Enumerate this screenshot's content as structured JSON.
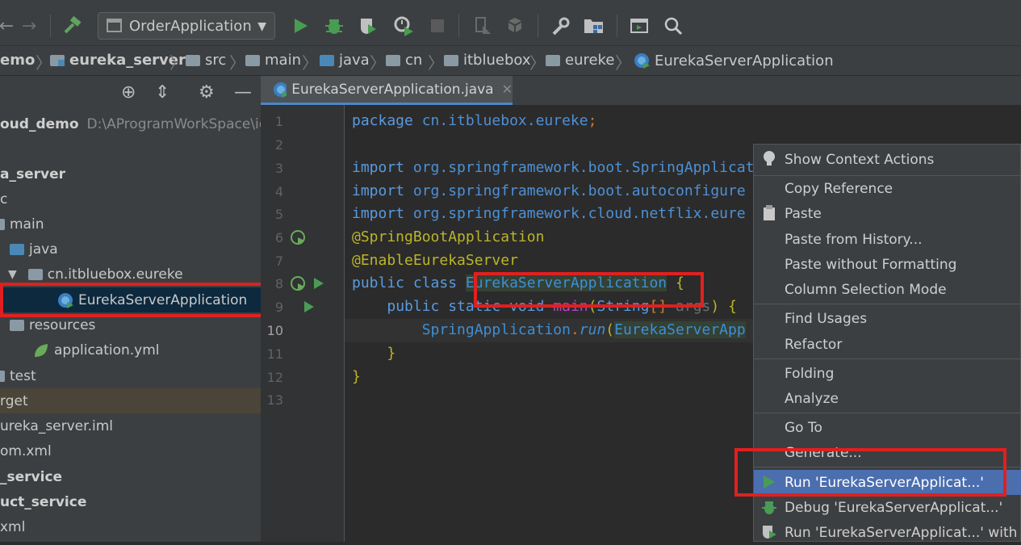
{
  "toolbar": {
    "run_config": "OrderApplication"
  },
  "breadcrumb": [
    "emo",
    "eureka_server",
    "src",
    "main",
    "java",
    "cn",
    "itbluebox",
    "eureke",
    "EurekaServerApplication"
  ],
  "project": {
    "root_name": "oud_demo",
    "root_path": "D:\\AProgramWorkSpace\\ide",
    "items": {
      "module": "a_server",
      "src": "c",
      "main": "main",
      "java": "java",
      "pkg": "cn.itbluebox.eureke",
      "app_class": "EurekaServerApplication",
      "resources": "resources",
      "yml": "application.yml",
      "test": "test",
      "target": "rget",
      "iml": "ureka_server.iml",
      "pom": "om.xml",
      "svc1": "_service",
      "svc2": "uct_service",
      "xml": "xml"
    }
  },
  "editor": {
    "tab_title": "EurekaServerApplication.java",
    "line_numbers": [
      "1",
      "2",
      "3",
      "4",
      "5",
      "6",
      "7",
      "8",
      "9",
      "10",
      "11",
      "12",
      "13"
    ],
    "code": {
      "l1_kw": "package",
      "l1_pkg": "cn.itbluebox.eureke",
      "l3_kw": "import",
      "l3_pkg": "org.springframework.boot.SpringApplicat",
      "l4_kw": "import",
      "l4_pkg": "org.springframework.boot.autoconfigure",
      "l5_kw": "import",
      "l5_pkg": "org.springframework.cloud.netflix.eure",
      "l6": "@SpringBootApplication",
      "l7": "@EnableEurekaServer",
      "l8_kw": "public class",
      "l8_cls": "EurekaServerApplication",
      "l9_kw": "public static void",
      "l9_fn": "main",
      "l9_type": "String",
      "l9_arr": "[]",
      "l9_arg": "args",
      "l10_cls": "SpringApplication",
      "l10_fn": "run",
      "l10_arg": "EurekaServerApp",
      "brace_open": "{",
      "brace_close": "}",
      "semi": ";",
      "dot": ".",
      "lparen": "(",
      "rparen": ")"
    }
  },
  "context_menu": {
    "items": [
      "Show Context Actions",
      "Copy Reference",
      "Paste",
      "Paste from History...",
      "Paste without Formatting",
      "Column Selection Mode",
      "Find Usages",
      "Refactor",
      "Folding",
      "Analyze",
      "Go To",
      "Generate...",
      "Run 'EurekaServerApplicat...'",
      "Debug 'EurekaServerApplicat...'",
      "Run 'EurekaServerApplicat...' with Co"
    ]
  },
  "colors": {
    "highlight": "#e02020",
    "menu_active": "#4b6eaf",
    "run_green": "#499c54"
  }
}
